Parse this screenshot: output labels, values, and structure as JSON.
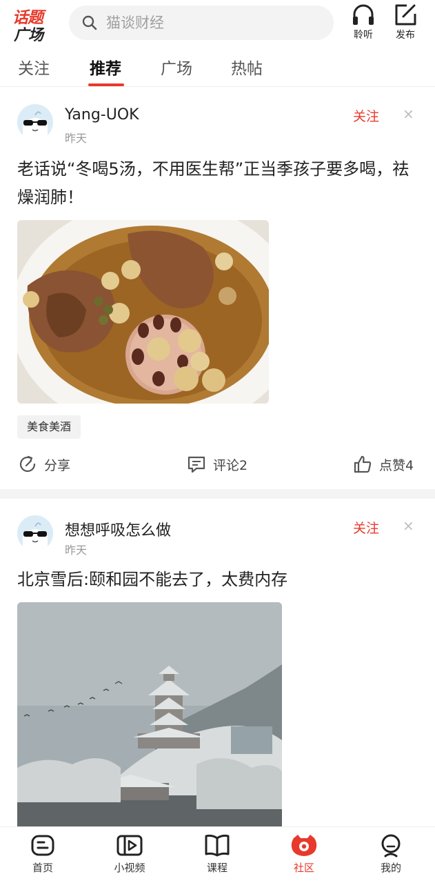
{
  "header": {
    "logo_line1": "话题",
    "logo_line2": "广场",
    "search_placeholder": "猫谈财经",
    "listen_label": "聆听",
    "publish_label": "发布"
  },
  "tabs": [
    {
      "label": "关注",
      "active": false
    },
    {
      "label": "推荐",
      "active": true
    },
    {
      "label": "广场",
      "active": false
    },
    {
      "label": "热帖",
      "active": false
    }
  ],
  "posts": [
    {
      "username": "Yang-UOK",
      "time": "昨天",
      "follow_label": "关注",
      "close_glyph": "×",
      "title": "老话说“冬喝5汤，不用医生帮”正当季孩子要多喝，祛燥润肺！",
      "image": "lotus-root-soup",
      "tag": "美食美酒",
      "share_label": "分享",
      "comment_label": "评论2",
      "like_label": "点赞4"
    },
    {
      "username": "想想呼吸怎么做",
      "time": "昨天",
      "follow_label": "关注",
      "close_glyph": "×",
      "title": "北京雪后:颐和园不能去了，太费内存",
      "image": "summer-palace-in-snow"
    }
  ],
  "bottom_nav": [
    {
      "label": "首页",
      "icon": "home-icon",
      "active": false
    },
    {
      "label": "小视频",
      "icon": "video-icon",
      "active": false
    },
    {
      "label": "课程",
      "icon": "book-icon",
      "active": false
    },
    {
      "label": "社区",
      "icon": "community-icon",
      "active": true
    },
    {
      "label": "我的",
      "icon": "profile-icon",
      "active": false
    }
  ],
  "colors": {
    "accent": "#e8392c",
    "text": "#222222",
    "muted": "#999999",
    "divider": "#f4f4f4"
  }
}
